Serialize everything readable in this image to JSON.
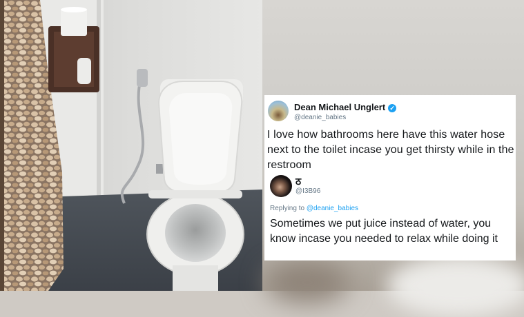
{
  "tweet": {
    "author_name": "Dean Michael Unglert",
    "author_handle": "@deanie_babies",
    "verified_icon": "verified-badge-icon",
    "text": "I love how bathrooms here have this water hose next to the toilet incase you get thirsty while in the restroom"
  },
  "reply": {
    "name": "ठ",
    "handle": "@I3B96",
    "replying_prefix": "Replying to ",
    "replying_to": "@deanie_babies",
    "text": "Sometimes we put juice instead of water, you know incase you needed to relax while doing it"
  },
  "colors": {
    "link": "#1da1f2",
    "text": "#14171a",
    "muted": "#657786"
  }
}
